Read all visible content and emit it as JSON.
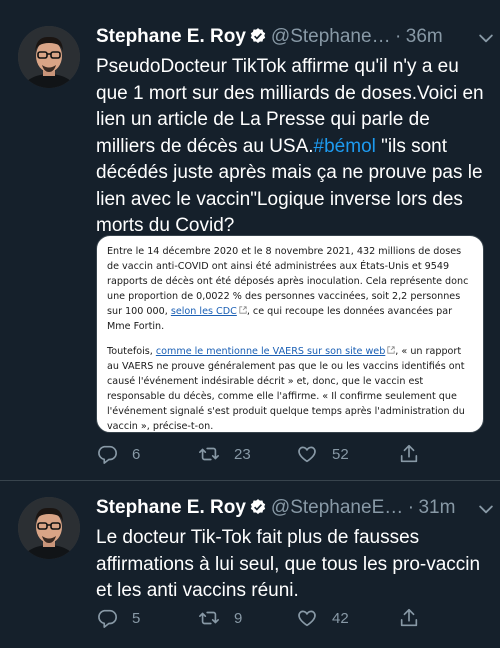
{
  "tweets": [
    {
      "name": "Stephane E. Roy",
      "handle": "@Stephane…",
      "separator": "·",
      "time": "36m",
      "text_before": "PseudoDocteur TikTok affirme qu'il n'y a eu que 1 mort sur des milliards de doses.Voici en lien un article de La Presse qui parle de milliers de décès au USA.",
      "hashtag": "#bémol",
      "text_after": " \"ils sont décédés juste après mais ça ne prouve pas le lien avec le vaccin\"Logique inverse lors des morts du Covid?",
      "card": {
        "p1_a": "Entre le 14 décembre 2020 et le 8 novembre 2021, 432 millions de doses de vaccin anti-COVID ont ainsi été administrées aux États-Unis et 9549 rapports de décès ont été déposés après inoculation. Cela représente donc une proportion de 0,0022 % des personnes vaccinées, soit 2,2 personnes sur 100 000, ",
        "p1_link": "selon les CDC",
        "p1_b": ", ce qui recoupe les données avancées par Mme Fortin.",
        "p2_a": "Toutefois, ",
        "p2_link": "comme le mentionne le VAERS sur son site web",
        "p2_b": ", « un rapport au VAERS ne prouve généralement pas que le ou les vaccins identifiés ont causé l'événement indésirable décrit » et, donc, que le vaccin est responsable du décès, comme elle l'affirme. « Il confirme seulement que l'événement signalé s'est produit quelque temps après l'administration du vaccin », précise-t-on."
      },
      "replies": "6",
      "retweets": "23",
      "likes": "52"
    },
    {
      "name": "Stephane E. Roy",
      "handle": "@StephaneE…",
      "separator": "·",
      "time": "31m",
      "text": "Le docteur Tik-Tok fait plus de fausses affirmations à lui seul,  que tous les pro-vaccin et les anti vaccins réuni.",
      "replies": "5",
      "retweets": "9",
      "likes": "42"
    }
  ],
  "colors": {
    "background": "#15202b",
    "secondary_text": "#8899a6",
    "hashtag": "#1d9bf0",
    "verified": "#ffffff"
  },
  "icons": [
    "verified-badge-icon",
    "more-chevron-icon",
    "reply-icon",
    "retweet-icon",
    "like-icon",
    "share-icon",
    "external-link-icon"
  ]
}
